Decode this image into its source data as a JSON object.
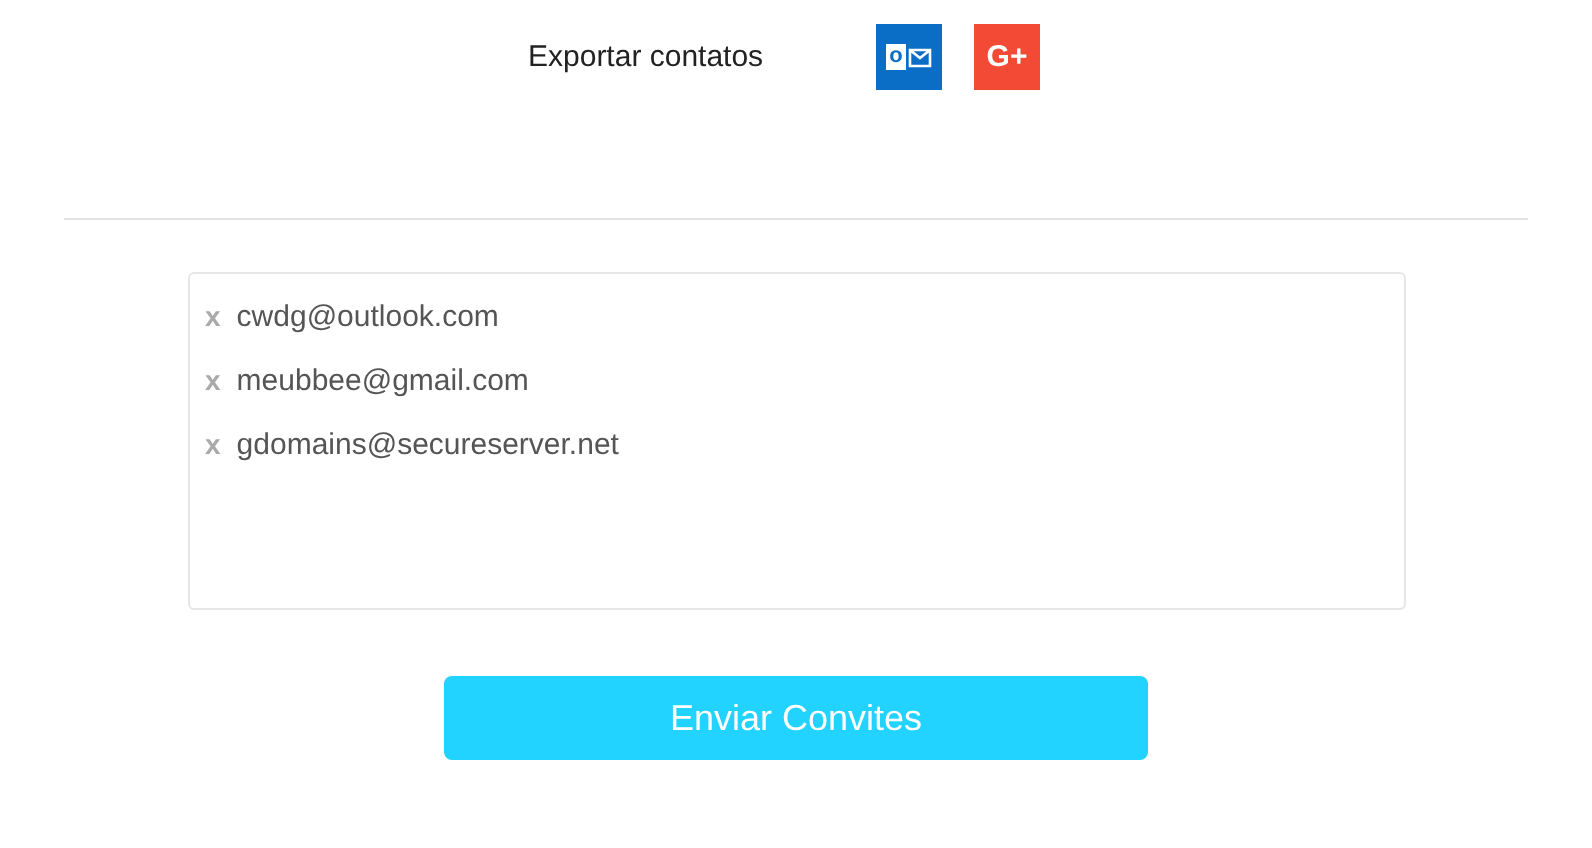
{
  "export": {
    "label": "Exportar contatos",
    "services": [
      {
        "kind": "outlook",
        "glyph": "o"
      },
      {
        "kind": "google_plus",
        "glyph": "G+"
      }
    ]
  },
  "recipients": [
    {
      "remove": "x",
      "email": "cwdg@outlook.com"
    },
    {
      "remove": "x",
      "email": "meubbee@gmail.com"
    },
    {
      "remove": "x",
      "email": "gdomains@secureserver.net"
    }
  ],
  "submit": "Enviar Convites"
}
